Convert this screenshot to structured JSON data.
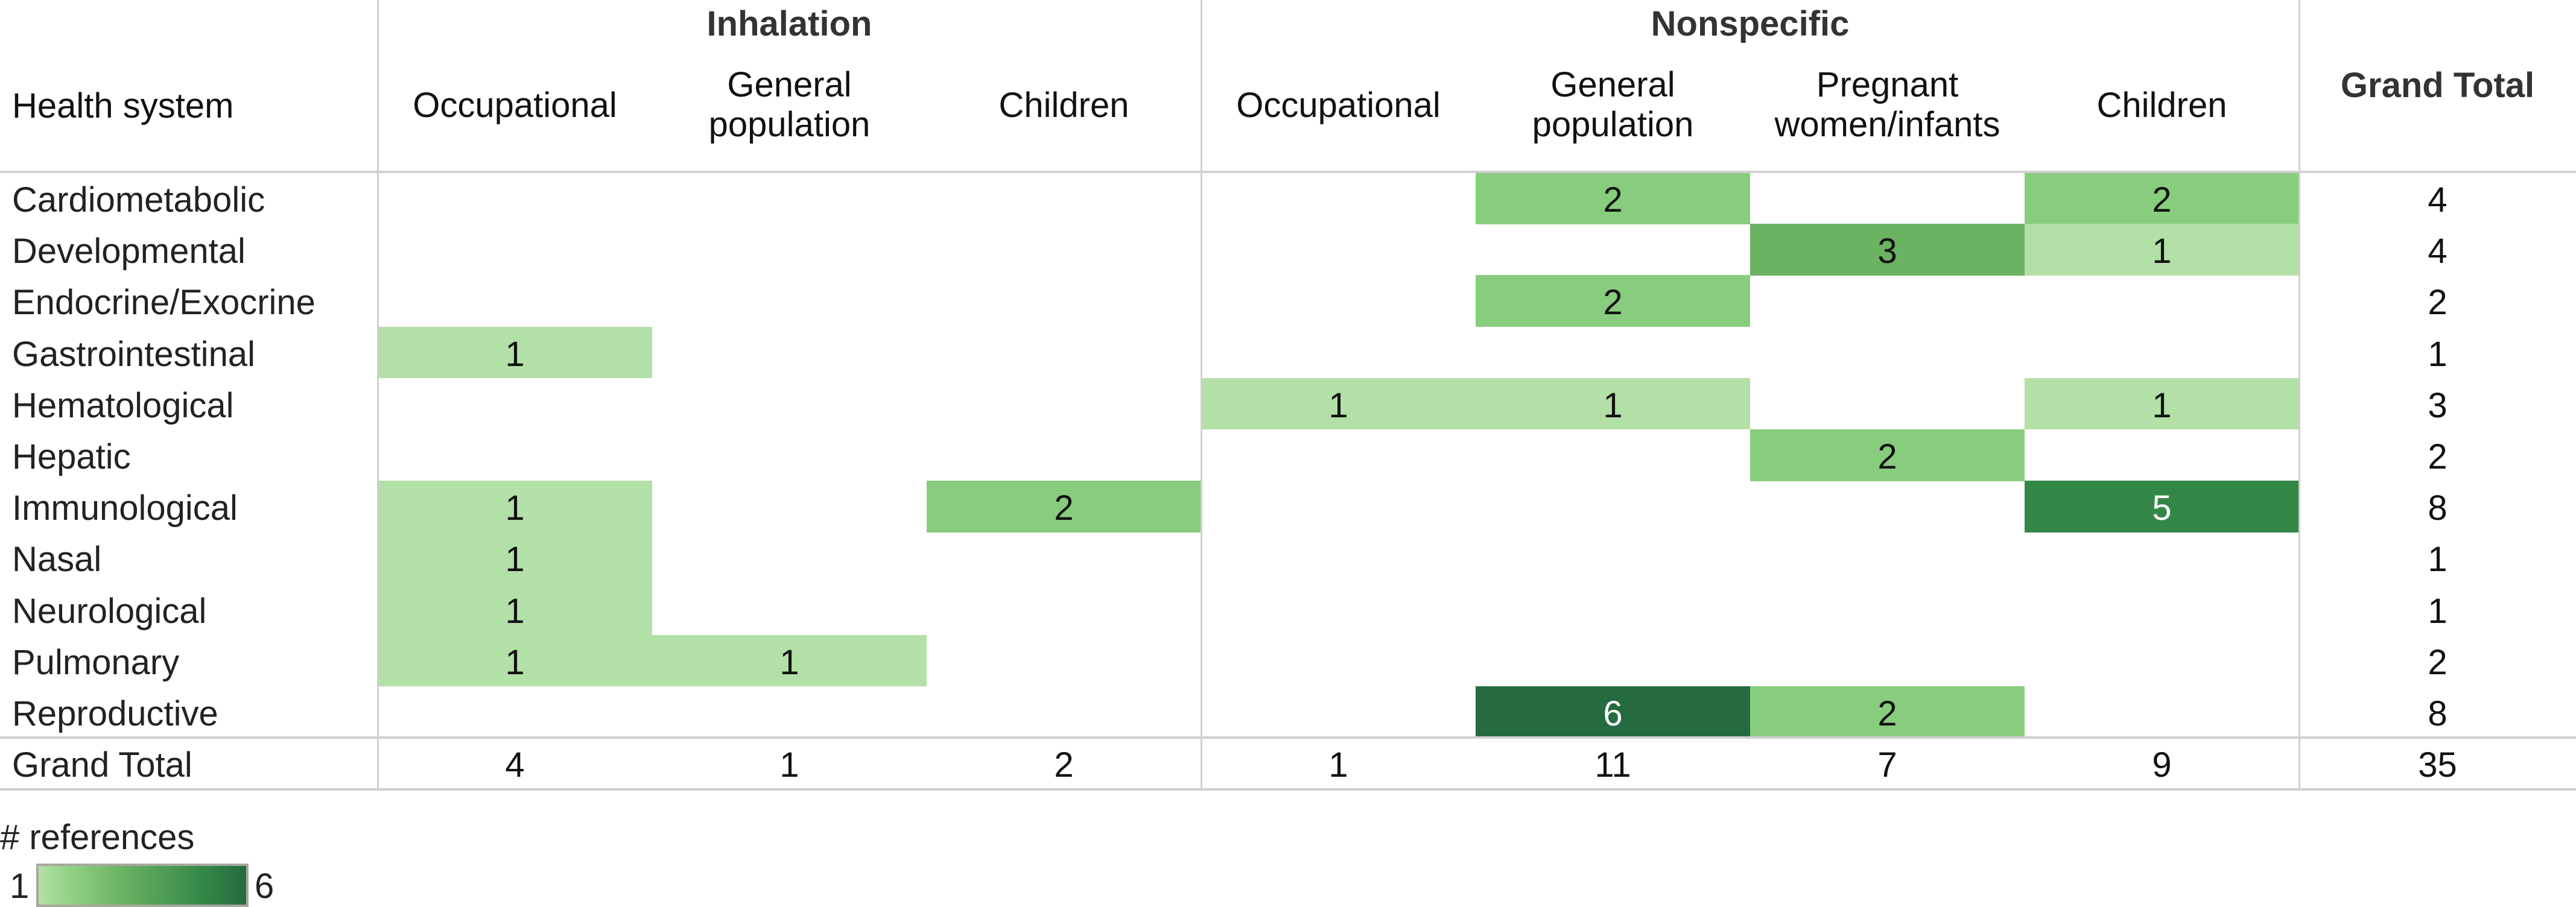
{
  "chart_data": {
    "type": "heatmap",
    "title": "",
    "row_header": "Health system",
    "column_groups": [
      {
        "label": "Inhalation",
        "columns": [
          "Occupational",
          "General population",
          "Children"
        ]
      },
      {
        "label": "Nonspecific",
        "columns": [
          "Occupational",
          "General population",
          "Pregnant women/infants",
          "Children"
        ]
      }
    ],
    "columns": [
      {
        "group": "Inhalation",
        "label": "Occupational",
        "lines": [
          "Occupational"
        ]
      },
      {
        "group": "Inhalation",
        "label": "General population",
        "lines": [
          "General",
          "population"
        ]
      },
      {
        "group": "Inhalation",
        "label": "Children",
        "lines": [
          "Children"
        ]
      },
      {
        "group": "Nonspecific",
        "label": "Occupational",
        "lines": [
          "Occupational"
        ]
      },
      {
        "group": "Nonspecific",
        "label": "General population",
        "lines": [
          "General",
          "population"
        ]
      },
      {
        "group": "Nonspecific",
        "label": "Pregnant women/infants",
        "lines": [
          "Pregnant",
          "women/infants"
        ]
      },
      {
        "group": "Nonspecific",
        "label": "Children",
        "lines": [
          "Children"
        ]
      }
    ],
    "rows": [
      "Cardiometabolic",
      "Developmental",
      "Endocrine/Exocrine",
      "Gastrointestinal",
      "Hematological",
      "Hepatic",
      "Immunological",
      "Nasal",
      "Neurological",
      "Pulmonary",
      "Reproductive"
    ],
    "values": [
      [
        null,
        null,
        null,
        null,
        2,
        null,
        2
      ],
      [
        null,
        null,
        null,
        null,
        null,
        3,
        1
      ],
      [
        null,
        null,
        null,
        null,
        2,
        null,
        null
      ],
      [
        1,
        null,
        null,
        null,
        null,
        null,
        null
      ],
      [
        null,
        null,
        null,
        1,
        1,
        null,
        1
      ],
      [
        null,
        null,
        null,
        null,
        null,
        2,
        null
      ],
      [
        1,
        null,
        2,
        null,
        null,
        null,
        5
      ],
      [
        1,
        null,
        null,
        null,
        null,
        null,
        null
      ],
      [
        1,
        null,
        null,
        null,
        null,
        null,
        null
      ],
      [
        1,
        1,
        null,
        null,
        null,
        null,
        null
      ],
      [
        null,
        null,
        null,
        null,
        6,
        2,
        null
      ]
    ],
    "row_totals": [
      4,
      4,
      2,
      1,
      3,
      2,
      8,
      1,
      1,
      2,
      8
    ],
    "grand_total_label": "Grand Total",
    "column_totals": [
      4,
      1,
      2,
      1,
      11,
      7,
      9
    ],
    "grand_total": 35,
    "color_scale": {
      "title": "# references",
      "min": 1,
      "max": 6,
      "min_label": "1",
      "max_label": "6",
      "colors": {
        "1": "#b3e0a6",
        "2": "#88cd7d",
        "3": "#6bb262",
        "4": "#4f9d56",
        "5": "#338746",
        "6": "#256b3f"
      },
      "light_text_threshold": 5
    },
    "legend_placement": "bottom-left"
  }
}
